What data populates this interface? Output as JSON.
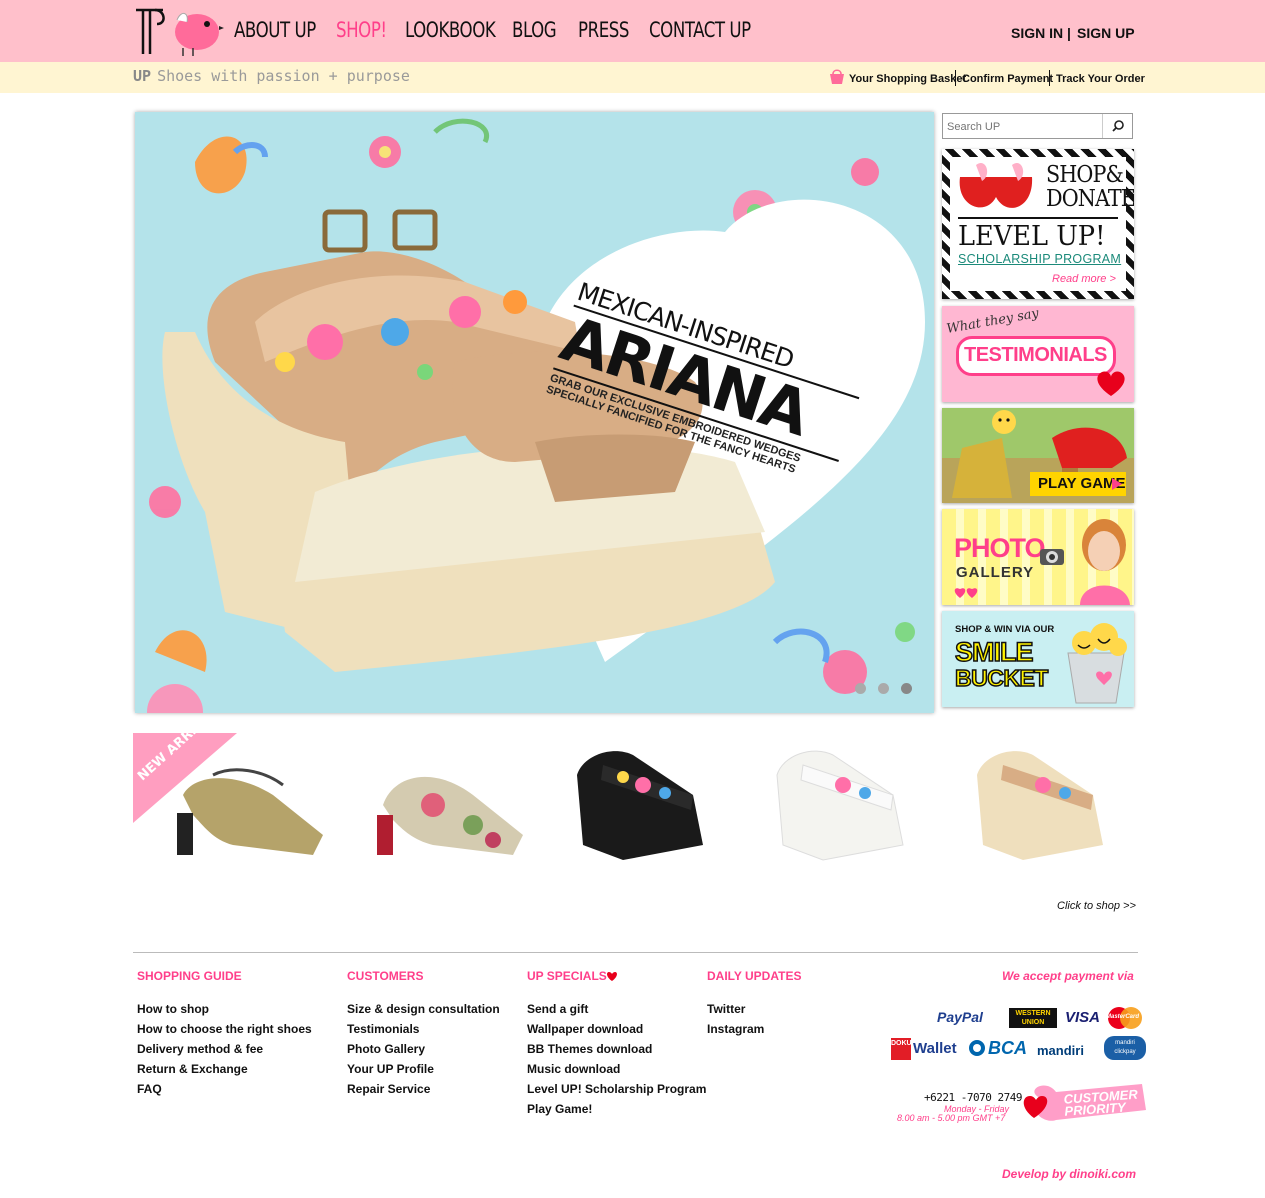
{
  "header": {
    "nav": [
      "ABOUT UP",
      "SHOP!",
      "LOOKBOOK",
      "BLOG",
      "PRESS",
      "CONTACT UP"
    ],
    "active_nav": "SHOP!",
    "sign_in": "SIGN IN",
    "sign_sep": "|",
    "sign_up": "SIGN UP"
  },
  "subbar": {
    "brand": "UP",
    "tagline": "Shoes with passion + purpose",
    "links": [
      "Your Shopping Basket",
      "Confirm Payment",
      "Track Your Order"
    ]
  },
  "hero": {
    "line1": "MEXICAN-INSPIRED",
    "title": "ARIANA",
    "sub1": "GRAB OUR EXCLUSIVE EMBROIDERED WEDGES",
    "sub2": "SPECIALLY FANCIFIED FOR THE FANCY HEARTS",
    "slide_count": 3,
    "active_slide": 3
  },
  "search": {
    "placeholder": "Search UP"
  },
  "sidebar": {
    "b1_top": "SHOP&",
    "b1_top2": "DONATE",
    "b1_mid": "LEVEL UP!",
    "b1_sub": "SCHOLARSHIP PROGRAM",
    "b1_more": "Read more >",
    "b2_top": "What they say",
    "b2_main": "TESTIMONIALS",
    "b3_main": "PLAY GAME",
    "b4_main": "PHOTO",
    "b4_sub": "GALLERY",
    "b5_top": "SHOP & WIN VIA OUR",
    "b5_main": "SMILE",
    "b5_sub": "BUCKET"
  },
  "products": {
    "ribbon": "NEW ARRIVALS",
    "click": "Click to shop >>"
  },
  "footer": {
    "cols": [
      {
        "title": "SHOPPING GUIDE",
        "items": [
          "How to shop",
          "How to choose the right shoes",
          "Delivery method & fee",
          "Return & Exchange",
          "FAQ"
        ]
      },
      {
        "title": "CUSTOMERS",
        "items": [
          "Size & design consultation",
          "Testimonials",
          "Photo Gallery",
          "Your UP Profile",
          "Repair Service"
        ]
      },
      {
        "title": "UP SPECIALS",
        "items": [
          "Send a gift",
          "Wallpaper download",
          "BB Themes download",
          "Music download",
          "Level UP! Scholarship Program",
          "Play Game!"
        ]
      },
      {
        "title": "DAILY UPDATES",
        "items": [
          "Twitter",
          "Instagram"
        ]
      }
    ],
    "payment_title": "We accept payment via",
    "payments": [
      "PayPal",
      "WESTERN UNION",
      "VISA",
      "MasterCard",
      "DOKU",
      "Wallet",
      "BCA",
      "mandiri",
      "mandiri clickpay"
    ],
    "phone": "+6221 -7070 2749",
    "hours1": "Monday - Friday",
    "hours2": "8.00 am - 5.00 pm GMT +7",
    "priority": "CUSTOMER PRIORITY",
    "credit": "Develop by dinoiki.com"
  },
  "colors": {
    "pink": "#ffc0cb",
    "accent": "#ff3f8a",
    "cream": "#fff5d2",
    "sky": "#b4e3ea"
  }
}
